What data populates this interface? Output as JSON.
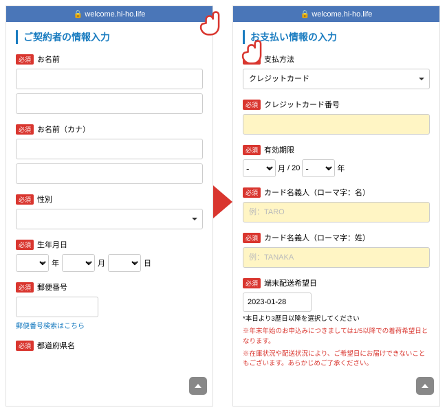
{
  "url": "welcome.hi-ho.life",
  "left": {
    "title": "ご契約者の情報入力",
    "req": "必須",
    "name_label": "お名前",
    "kana_label": "お名前（カナ）",
    "gender_label": "性別",
    "dob_label": "生年月日",
    "year": "年",
    "month": "月",
    "day": "日",
    "postal_label": "郵便番号",
    "postal_link": "郵便番号検索はこちら",
    "pref_label": "都道府県名"
  },
  "right": {
    "title": "お支払い情報の入力",
    "req": "必須",
    "method_label": "支払方法",
    "method_value": "クレジットカード",
    "cc_label": "クレジットカード番号",
    "exp_label": "有効期限",
    "month": "月",
    "twenty": "/ 20",
    "year": "年",
    "holder_first_label": "カード名義人（ローマ字：名）",
    "holder_first_ph": "例：TARO",
    "holder_last_label": "カード名義人（ローマ字：姓）",
    "holder_last_ph": "例：TANAKA",
    "ship_label": "端末配送希望日",
    "ship_value": "2023-01-28",
    "note1": "*本日より3歴日以降を選択してください",
    "note2": "※年末年始のお申込みにつきましては1/5以降での着荷希望日となります。",
    "note3": "※在庫状況や配送状況により、ご希望日にお届けできないこともございます。あらかじめご了承ください。"
  }
}
